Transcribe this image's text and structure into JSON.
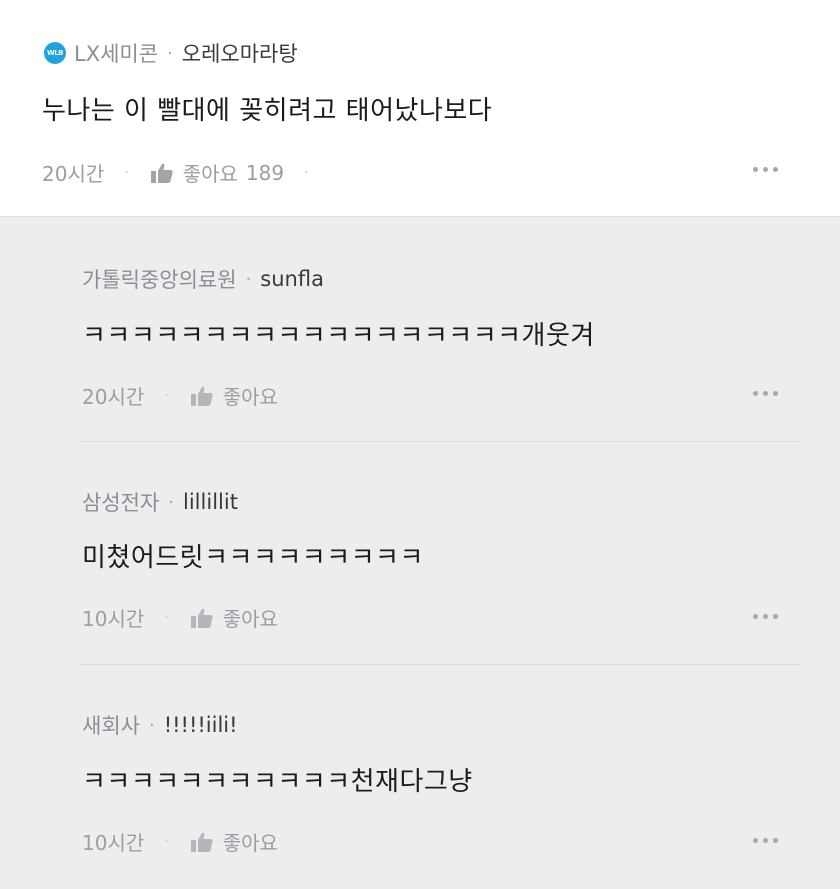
{
  "post": {
    "company": "LX세미콘",
    "dot": "·",
    "nickname": "오레오마라탕",
    "text": "누나는 이 빨대에 꽂히려고 태어났나보다",
    "time": "20시간",
    "sep1": "·",
    "like_label": "좋아요",
    "like_count": "189",
    "sep2": "·"
  },
  "replies": [
    {
      "company": "가톨릭중앙의료원",
      "dot": "·",
      "nickname": "sunfla",
      "text": "ㅋㅋㅋㅋㅋㅋㅋㅋㅋㅋㅋㅋㅋㅋㅋㅋㅋㅋ개웃겨",
      "time": "20시간",
      "sep": "·",
      "like_label": "좋아요"
    },
    {
      "company": "삼성전자",
      "dot": "·",
      "nickname": "lillillit",
      "text": "미쳤어드릿ㅋㅋㅋㅋㅋㅋㅋㅋㅋ",
      "time": "10시간",
      "sep": "·",
      "like_label": "좋아요"
    },
    {
      "company": "새회사",
      "dot": "·",
      "nickname": "!!!!!iili!",
      "text": "ㅋㅋㅋㅋㅋㅋㅋㅋㅋㅋㅋ천재다그냥",
      "time": "10시간",
      "sep": "·",
      "like_label": "좋아요"
    }
  ],
  "icons": {
    "company_badge": "company-badge-icon",
    "like": "thumbs-up-icon",
    "more": "more-options-icon"
  },
  "colors": {
    "badge": "#1fa2e1",
    "reply_background": "#ededf0"
  }
}
